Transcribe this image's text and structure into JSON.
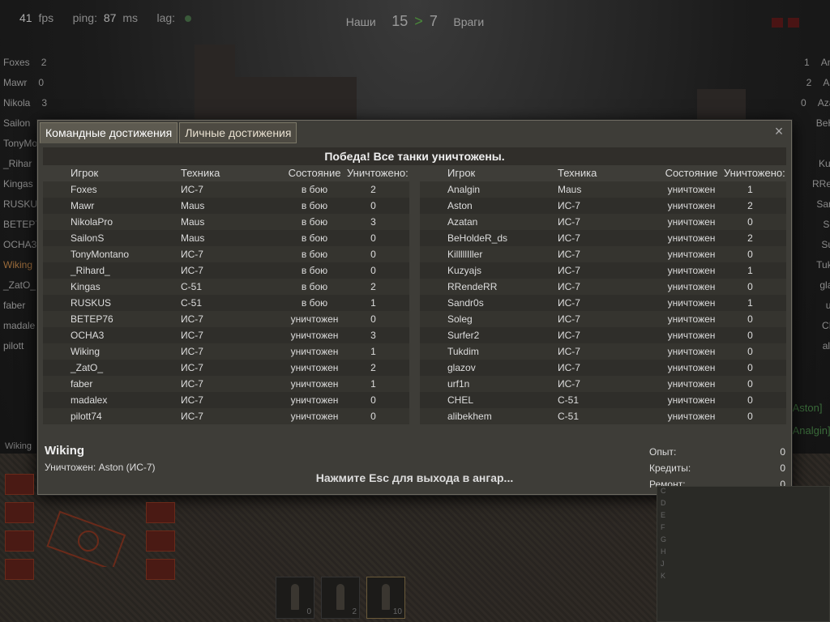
{
  "hud": {
    "fps_value": "41",
    "fps_label": "fps",
    "ping_label": "ping:",
    "ping_value": "87",
    "ping_unit": "ms",
    "lag_label": "lag:"
  },
  "score": {
    "ours_label": "Наши",
    "ours": "15",
    "arrow": ">",
    "theirs": "7",
    "enemies_label": "Враги"
  },
  "side_list_left": [
    {
      "name": "Foxes",
      "kills": "2"
    },
    {
      "name": "Mawr",
      "kills": "0"
    },
    {
      "name": "Nikola",
      "kills": "3"
    },
    {
      "name": "Sailon",
      "kills": ""
    },
    {
      "name": "TonyMo",
      "kills": ""
    },
    {
      "name": "_Rihar",
      "kills": ""
    },
    {
      "name": "Kingas",
      "kills": ""
    },
    {
      "name": "RUSKUS",
      "kills": ""
    },
    {
      "name": "BETEP7",
      "kills": ""
    },
    {
      "name": "OCHA3",
      "kills": ""
    },
    {
      "name": "Wiking",
      "kills": ""
    },
    {
      "name": "_ZatO_",
      "kills": ""
    },
    {
      "name": "faber",
      "kills": ""
    },
    {
      "name": "madale",
      "kills": ""
    },
    {
      "name": "pilott",
      "kills": ""
    }
  ],
  "side_list_right": [
    {
      "name": "Analgi",
      "kills": "1"
    },
    {
      "name": "Aston",
      "kills": "2"
    },
    {
      "name": "Azatan",
      "kills": "0"
    },
    {
      "name": "BeHold",
      "kills": ""
    },
    {
      "name": "Killll",
      "kills": ""
    },
    {
      "name": "Kuzyaj",
      "kills": ""
    },
    {
      "name": "RRende",
      "kills": ""
    },
    {
      "name": "Sandr0",
      "kills": ""
    },
    {
      "name": "Soleg",
      "kills": ""
    },
    {
      "name": "Surfer",
      "kills": ""
    },
    {
      "name": "Tukdim",
      "kills": ""
    },
    {
      "name": "glazov",
      "kills": ""
    },
    {
      "name": "urf1n",
      "kills": ""
    },
    {
      "name": "CHEL",
      "kills": ""
    },
    {
      "name": "alibek",
      "kills": ""
    }
  ],
  "right_side_names": [
    "[Aston]",
    "[Analgin]"
  ],
  "dialog": {
    "tabs": [
      "Командные достижения",
      "Личные достижения"
    ],
    "close_label": "×",
    "banner": "Победа! Все танки уничтожены.",
    "headers": {
      "player": "Игрок",
      "vehicle": "Техника",
      "state": "Состояние",
      "kills": "Уничтожено:"
    },
    "team_left": [
      {
        "name": "Foxes",
        "vehicle": "ИС-7",
        "state": "в бою",
        "kills": "2"
      },
      {
        "name": "Mawr",
        "vehicle": "Maus",
        "state": "в бою",
        "kills": "0"
      },
      {
        "name": "NikolaPro",
        "vehicle": "Maus",
        "state": "в бою",
        "kills": "3"
      },
      {
        "name": "SailonS",
        "vehicle": "Maus",
        "state": "в бою",
        "kills": "0"
      },
      {
        "name": "TonyMontano",
        "vehicle": "ИС-7",
        "state": "в бою",
        "kills": "0"
      },
      {
        "name": "_Rihard_",
        "vehicle": "ИС-7",
        "state": "в бою",
        "kills": "0"
      },
      {
        "name": "Kingas",
        "vehicle": "С-51",
        "state": "в бою",
        "kills": "2"
      },
      {
        "name": "RUSKUS",
        "vehicle": "С-51",
        "state": "в бою",
        "kills": "1"
      },
      {
        "name": "BETEP76",
        "vehicle": "ИС-7",
        "state": "уничтожен",
        "kills": "0"
      },
      {
        "name": "OCHA3",
        "vehicle": "ИС-7",
        "state": "уничтожен",
        "kills": "3"
      },
      {
        "name": "Wiking",
        "vehicle": "ИС-7",
        "state": "уничтожен",
        "kills": "1",
        "self": true
      },
      {
        "name": "_ZatO_",
        "vehicle": "ИС-7",
        "state": "уничтожен",
        "kills": "2"
      },
      {
        "name": "faber",
        "vehicle": "ИС-7",
        "state": "уничтожен",
        "kills": "1"
      },
      {
        "name": "madalex",
        "vehicle": "ИС-7",
        "state": "уничтожен",
        "kills": "0"
      },
      {
        "name": "pilott74",
        "vehicle": "ИС-7",
        "state": "уничтожен",
        "kills": "0"
      }
    ],
    "team_right": [
      {
        "name": "Analgin",
        "vehicle": "Maus",
        "state": "уничтожен",
        "kills": "1"
      },
      {
        "name": "Aston",
        "vehicle": "ИС-7",
        "state": "уничтожен",
        "kills": "2"
      },
      {
        "name": "Azatan",
        "vehicle": "ИС-7",
        "state": "уничтожен",
        "kills": "0"
      },
      {
        "name": "BeHoldeR_ds",
        "vehicle": "ИС-7",
        "state": "уничтожен",
        "kills": "2"
      },
      {
        "name": "KilllllIller",
        "vehicle": "ИС-7",
        "state": "уничтожен",
        "kills": "0"
      },
      {
        "name": "Kuzyajs",
        "vehicle": "ИС-7",
        "state": "уничтожен",
        "kills": "1"
      },
      {
        "name": "RRendeRR",
        "vehicle": "ИС-7",
        "state": "уничтожен",
        "kills": "0"
      },
      {
        "name": "Sandr0s",
        "vehicle": "ИС-7",
        "state": "уничтожен",
        "kills": "1"
      },
      {
        "name": "Soleg",
        "vehicle": "ИС-7",
        "state": "уничтожен",
        "kills": "0"
      },
      {
        "name": "Surfer2",
        "vehicle": "ИС-7",
        "state": "уничтожен",
        "kills": "0"
      },
      {
        "name": "Tukdim",
        "vehicle": "ИС-7",
        "state": "уничтожен",
        "kills": "0"
      },
      {
        "name": "glazov",
        "vehicle": "ИС-7",
        "state": "уничтожен",
        "kills": "0"
      },
      {
        "name": "urf1n",
        "vehicle": "ИС-7",
        "state": "уничтожен",
        "kills": "0"
      },
      {
        "name": "CHEL",
        "vehicle": "С-51",
        "state": "уничтожен",
        "kills": "0"
      },
      {
        "name": "alibekhem",
        "vehicle": "С-51",
        "state": "уничтожен",
        "kills": "0"
      }
    ],
    "player_name": "Wiking",
    "killed_by": "Уничтожен: Aston (ИС-7)",
    "esc_hint": "Нажмите Esc для выхода в ангар...",
    "stats": [
      {
        "label": "Опыт:",
        "value": "0"
      },
      {
        "label": "Кредиты:",
        "value": "0"
      },
      {
        "label": "Ремонт:",
        "value": "0"
      }
    ]
  },
  "left_hud": {
    "player_name": "Wiking"
  },
  "ammo": [
    {
      "count": "0",
      "selected": false
    },
    {
      "count": "2",
      "selected": false
    },
    {
      "count": "10",
      "selected": true
    }
  ],
  "minimap_rows": [
    "C",
    "D",
    "E",
    "F",
    "G",
    "H",
    "J",
    "K"
  ],
  "colors": {
    "self_highlight": "#e9a23a",
    "dialog_bg": "#3e3d38",
    "banner_bg": "#302e2a"
  }
}
